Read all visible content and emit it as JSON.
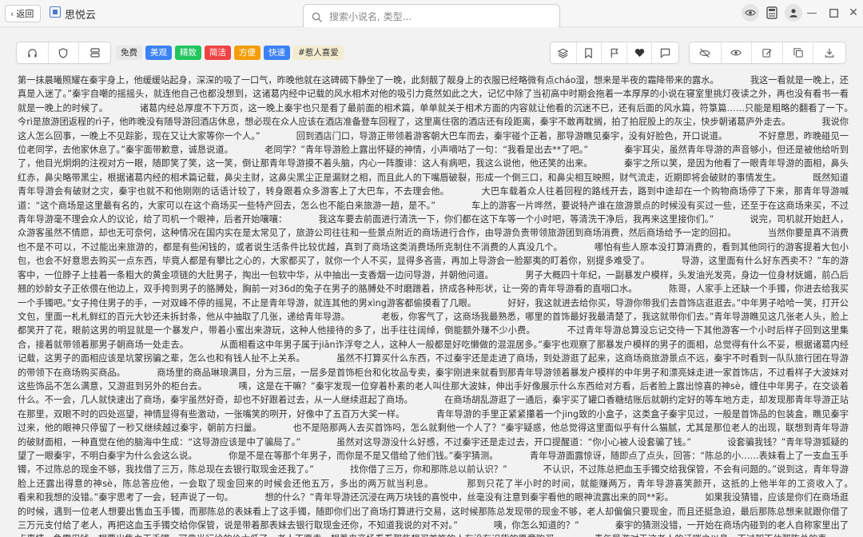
{
  "titlebar": {
    "back_label": "返回",
    "app_title": "思悦云",
    "search_placeholder": "搜索小说名, 类型..."
  },
  "toolbar": {
    "tags": [
      {
        "label": "免费",
        "color": "#e8e8e8",
        "text_color": "#333333"
      },
      {
        "label": "美观",
        "color": "#3b82f6",
        "text_color": "#ffffff"
      },
      {
        "label": "精致",
        "color": "#22c55e",
        "text_color": "#ffffff"
      },
      {
        "label": "简洁",
        "color": "#ef4444",
        "text_color": "#ffffff"
      },
      {
        "label": "方便",
        "color": "#f59e0b",
        "text_color": "#ffffff"
      },
      {
        "label": "快速",
        "color": "#3b82f6",
        "text_color": "#ffffff"
      },
      {
        "label": "#惹人喜爱",
        "color": "#f3ecd0",
        "text_color": "#333333"
      }
    ],
    "left_icons": [
      "headphones-icon",
      "shield-icon",
      "drive-icon"
    ],
    "middle_icons": [
      "layers-icon",
      "bookmark-icon",
      "flag-icon",
      "heart-icon",
      "comment-icon"
    ],
    "right_icons": [
      "eye-off-icon",
      "eye-icon",
      "edit-icon",
      "copy-icon",
      "download-icon"
    ]
  },
  "colors": {
    "accent": "#4a7bd0",
    "background": "#f2f2f2",
    "text": "#333333"
  },
  "article": {
    "paragraphs": [
      "第一抹晨曦照耀在秦宇身上，他缓缓站起身，深深的吸了一口气，昨晚他就在这碑碣下静坐了一晚，此刻靓了靓身上的衣服已经略微有点cháo湿，想来是半夜的霜降带来的露水。",
      "我这一看就是一晚上，还真是入迷了。”秦宇自嘲的摇摇头，就连他自己也都没想到，这诸葛内经中记载的风水相术对他的吸引力竟然如此之大，记忆中除了当初高中时期会拖着一本厚厚的小说在寝室里挑灯夜读之外，再也没有看书一看就是一晚上的时候了。",
      "诸葛内经总厚度不下万页，这一晚上秦宇也只是看了最前面的相术篇，单单就关于相术方面的内容就让他看的沉迷不已，还有后面的风水篇，符箓篇……只能是粗略的翻看了一下。",
      "今rì是旅游团返程的rì子，他昨晚没有随导游回酒店休息，想必现在众人应该在酒店准备登车回程了，这里离住宿的酒店还有段距离，秦宇不敢再耽搁，拍了拍屁股上的灰尘，快步朝诸葛庐外走去。",
      "我说你这人怎么回事，一晚上不见踪影，现在又让大家等你一个人。”",
      "回到酒店门口，导游正带领着游客朝大巴车而去，秦宇碰个正着，那导游瞧见秦宇，没有好脸色，开口说道。",
      "不好意思，昨晚碰见一位老同学，去他家休息了。”秦宇面带歉意，诚恳说道。",
      "老同学？”青年导游脸上露出怀疑的神情，小声嘀咕了一句：“我看是出去**了吧。”",
      "秦宇耳尖，虽然青年导游的声音够小，但还是被他给听到了，他目光炯炯的注视对方一眼，随即笑了笑，这一笑，倒让那青年导游摸不着头脑，内心一阵腹诽：这人有病吧，我这么说他，他还笑的出来。",
      "秦宇之所以笑，是因为他看了一眼青年导游的面相，鼻头红赤，鼻尖略带黑尘，根据诸葛内经的相术篇记载，鼻尖主财，这鼻尖黑尘正是漏财之相，而且此人的下嘴唇破裂，形成一个倒三口，和鼻尖相互映照，财气流走，近期即将会破财的事情发生。",
      "既然知道青年导游会有破财之灾，秦宇也就不和他刚刚的话语计较了，转身跟着众多游客上了大巴车，不去理会他。",
      "大巴车载着众人往着回程的路线开去，路到中途却在一个购物商场停了下来，那青年导游喊道：“这个商场是这里最有名的，大家可以在这个商场买一些特产回去，怎么也不能白来旅游一趟，是不。”",
      "车上的游客一片哗然，要说特产谁在旅游景点的时候没有买过一些，还至于在这商场来买，不过青年导游毫不理会众人的议论，给了司机一个眼神，后者开始嚷嚷：",
      "我这车要去前面进行清洗一下，你们都在这下车等一个小时吧，等清洗干净后，我再来这里接你们。”",
      "说完，司机就开始赶人，众游客虽然不情愿，却也无可奈何，这种情况在国内实在是太常见了，旅游公司往往和一些景点附近的商场进行合作，由导游负责带领旅游团到商场消费，然后商场给予一定的回扣。",
      "当然你要是真不消费也不是不可以，不过能出来旅游的，都是有些闲钱的，或者说生活条件比较优越，真到了商场这类消费场所克制住不消费的人真没几个。",
      "哪怕有些人原本没打算消费的，看到其他同行的游客提着大包小包，也会不好意思去购买一点东西，毕竟人都是有攀比之心的，大家都买了，就你一个人不买，显得多吝啬，再加上导游会一脸鄙夷的盯着你，别提多难受了。",
      "导游，这里面有什么好东西卖不？”车的游客中，一位脖子上挂着一条粗大的黄金项链的大肚男子，掏出一包软中华，从中抽出一支香烟一边问导游，并朝他问道。",
      "男子大概四十年纪，一副暴发户模样，头发油光发亮，身边一位身材妩媚，前凸后翘的妙龄女子正依偎在他边上，双手挎到男子的胳膊处，胸前一对36d的兔子在男子的胳膊处不时磨蹭着，挤成各种形状，让一旁的青年导游看的直咽口水。",
      "陈哥，人家手上还缺一个手镯，你进去给我买一个手镯吧。”女子挎住男子的手，一对双峰不停的摇晃，不止是青年导游，就连其他的男xìng游客都偷摸看了几眼。",
      "好好，我这就进去给你买，导游你带我们去首饰店逛逛去。”中年男子哈哈一笑，打开公文包，里面一札札鲜红的百元大钞还未拆封条，他从中抽取了几张，递给青年导游。",
      "老板，你客气了，这商场我最熟悉，哪里的首饰最好我最清楚了，我这就带你们去。”青年导游瞧见这几张老人头，脸上都笑开了花，眼前这男的明显就是一个暴发户，带着小蜜出来游玩，这种人他接待的多了，出手往往阔绰，倒能额外赚不少小费。",
      "不过青年导游总算没忘记交待一下其他游客一个小时后样子回到这里集合，接着就带领着那男子朝商场一处走去。",
      "从面相看这中年男子属于jiān诈浮夸之人，这种人一般都是好吃懒做的混混居多。”秦宇也观察了那暴发户模样的男子的面相，总觉得有什么不妥，根据诸葛内经记载，这男子的面相应该是坑蒙拐骗之辈，怎么也和有钱人扯不上关系。",
      "虽然不打算买什么东西，不过秦宇还是走进了商场，到处游逛了起来，这商场商旅游景点不远，秦宇不时看到一队队旅行团在导游的带领下在商场购买商品。",
      "商场里的商品琳琅满目，分为三层，一层多是首饰柜台和化妆品专卖，秦宇刚进来就看到那青年导游领着暴发户模样的中年男子和漂亮妹走进一家首饰店，不过看样子大波妹对这些饰品不怎么满意，又游逛到另外的柜台去。",
      "咦，这是在干嘛？”秦宇发现一位穿着朴素的老人叫住那大波妹，伸出手好像展示什么东西给对方看，后者脸上露出惊喜的神sè，缠住中年男子，在交谈着什么。不一会，几人就快速出了商场，秦宇虽然好奇，却也不好跟着过去，从一人继续逛起了商场。",
      "在商场胡乱游逛了一通后，秦宇买了罐口香糖结账后就朝约定好的等车地方走，却发现那青年导游正站在那里，双眼不时的四处巡望，神情显得有些激动，一张嘴笑的咧开，好像中了五百万大奖一样。",
      "青年导游的手里正紧紧攥着一个jing致的小盒子，这类盒子秦宇见过，一般是首饰品的包装盒，瞧见秦宇过来，他的眼神只停留了一秒又继续越过秦宇，朝前方扫量。",
      "也不是陪那两人去买首饰吗，怎么就剩他一个人了？”秦宇疑惑，他总觉得这里面似乎有什么猫腻，尤其是那位老人的出现，联想到青年导游的破财面相，一种直觉在他的脑海中生成：“这导游应该是中了骗局了。”",
      "虽然对这导游没什么好感，不过秦宇还是走过去，开口提醒道：“你小心被人设套骗了钱。”",
      "设套骗我钱？”青年导游狐疑的望了一眼秦宇，不明白秦宇为什么会这么说。",
      "你是不是在等那个年男子，而你是不是又借给了他们钱。”秦宇猜测。",
      "青年导游面露惊讶，随即点了点头，回答：“陈总的小……表妹看上了一支血玉手镯，不过陈总的现金不够，我找借了三万，陈总现在去银行取现金还我了。”",
      "找你借了三万，你和那陈总以前认识？”",
      "不认识，不过陈总把血玉手镯交给我保管，不会有问题的。”说到这，青年导游脸上还露出得意的神sè，陈总答应他，一会取了现金回来的时候会还他五万，多出的两万就当利息。",
      "那到只花了半小时的时间，就能赚两万，青年导游喜笑颜开，这抵的上他半年的工资收入了。",
      "看来和我想的没错。”秦宇思考了一会，轻声说了一句。",
      "想的什么？”青年导游还沉浸在两万块钱的喜悦中，丝毫没有注意到秦宇看他的眼神流露出来的同**彩。",
      "如果我没猜错，应该是你们在商场逛的时候，遇到一位老人想要出售血玉手镯，而那陈总的表妹看上了这手镯，随即你们出了商场打算进行交易，这时候那陈总发现带的现金不够，老人却偏偏只要现金，而且还挺急迫，最后那陈总想来就跟你借了三万元支付给了老人，再把这血玉手镯交给你保管，说是带着那表妹去银行取现金还你，不知道我说的对不对。”",
      "咦，你怎么知道的？”",
      "秦宇的猜测没错，一开始在商场内碰到的老人自称家里出了点事情，急需用钱，想要出售血玉手镯，可典当行给的价太低了，老人不愿卖，想着来商场看看那些想买首饰的人有没有识货的愿意购买。",
      "青年导游对于这老人的话嗤之以鼻，不过架不住那陈总的表"
    ]
  }
}
